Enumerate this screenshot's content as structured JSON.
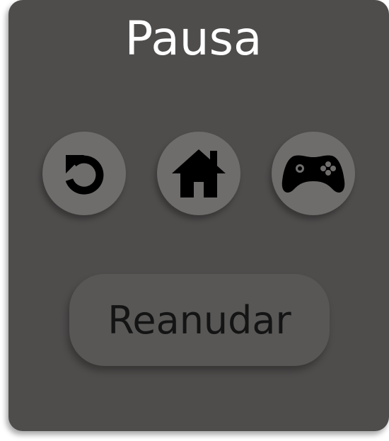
{
  "dialog": {
    "title": "Pausa"
  },
  "actions": [
    {
      "id": "restart",
      "icon": "restart-icon"
    },
    {
      "id": "home",
      "icon": "home-icon"
    },
    {
      "id": "games",
      "icon": "gamepad-icon"
    }
  ],
  "resume_label": "Reanudar",
  "colors": {
    "panel": "#4f4d4c",
    "icon_button": "#6f6d6c",
    "resume_button": "#585756",
    "title_text": "#ffffff",
    "icon": "#000000"
  }
}
